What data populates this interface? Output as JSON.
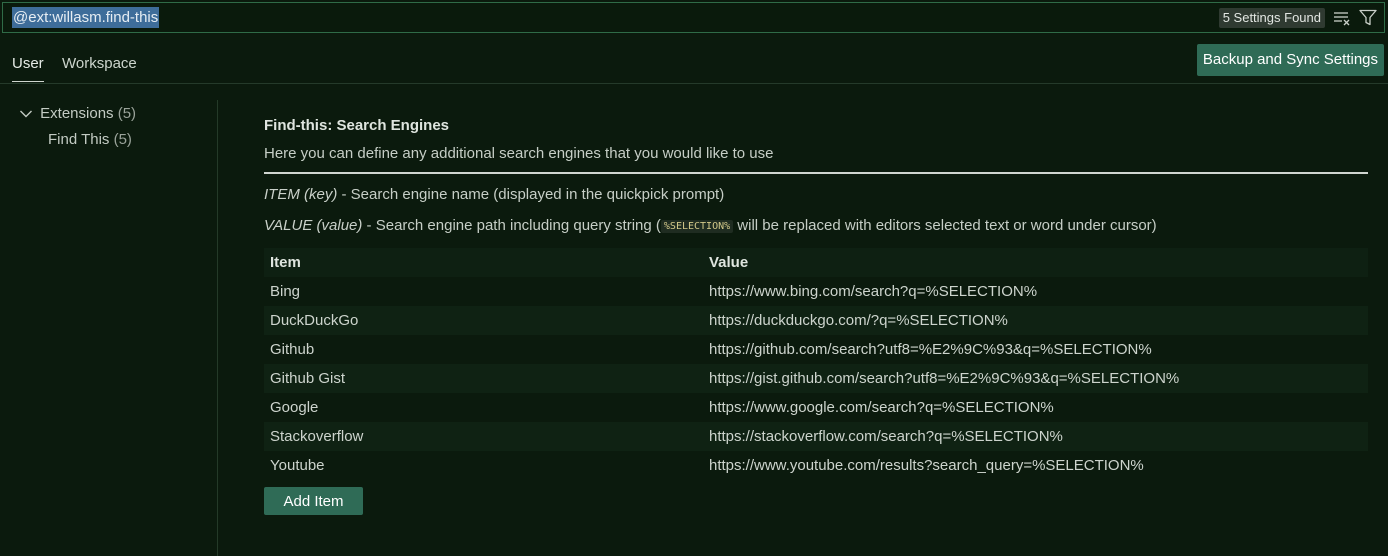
{
  "search": {
    "query": "@ext:willasm.find-this",
    "result_count": "5 Settings Found"
  },
  "tabs": {
    "user": "User",
    "workspace": "Workspace",
    "backup_button": "Backup and Sync Settings"
  },
  "sidebar": {
    "extensions_label": "Extensions",
    "extensions_count": "(5)",
    "find_this_label": "Find This",
    "find_this_count": "(5)"
  },
  "setting": {
    "title": "Find-this: Search Engines",
    "description": "Here you can define any additional search engines that you would like to use",
    "item_key_em": "ITEM (key)",
    "item_key_text": " - Search engine name (displayed in the quickpick prompt)",
    "value_em": "VALUE (value)",
    "value_text_before": " - Search engine path including query string (",
    "value_code": "%SELECTION%",
    "value_text_after": " will be replaced with editors selected text or word under cursor)"
  },
  "table": {
    "headers": {
      "item": "Item",
      "value": "Value"
    },
    "rows": [
      {
        "item": "Bing",
        "value": "https://www.bing.com/search?q=%SELECTION%"
      },
      {
        "item": "DuckDuckGo",
        "value": "https://duckduckgo.com/?q=%SELECTION%"
      },
      {
        "item": "Github",
        "value": "https://github.com/search?utf8=%E2%9C%93&q=%SELECTION%"
      },
      {
        "item": "Github Gist",
        "value": "https://gist.github.com/search?utf8=%E2%9C%93&q=%SELECTION%"
      },
      {
        "item": "Google",
        "value": "https://www.google.com/search?q=%SELECTION%"
      },
      {
        "item": "Stackoverflow",
        "value": "https://stackoverflow.com/search?q=%SELECTION%"
      },
      {
        "item": "Youtube",
        "value": "https://www.youtube.com/results?search_query=%SELECTION%"
      }
    ],
    "add_button": "Add Item"
  },
  "icons": {
    "clear_filter": "clear-filter-icon",
    "filter": "filter-icon",
    "chevron": "chevron-down-icon"
  },
  "colors": {
    "background": "#0b1a0d",
    "accent_button": "#2f6b56",
    "search_border": "#2f6b47",
    "selection_highlight": "#3e6d9a"
  }
}
